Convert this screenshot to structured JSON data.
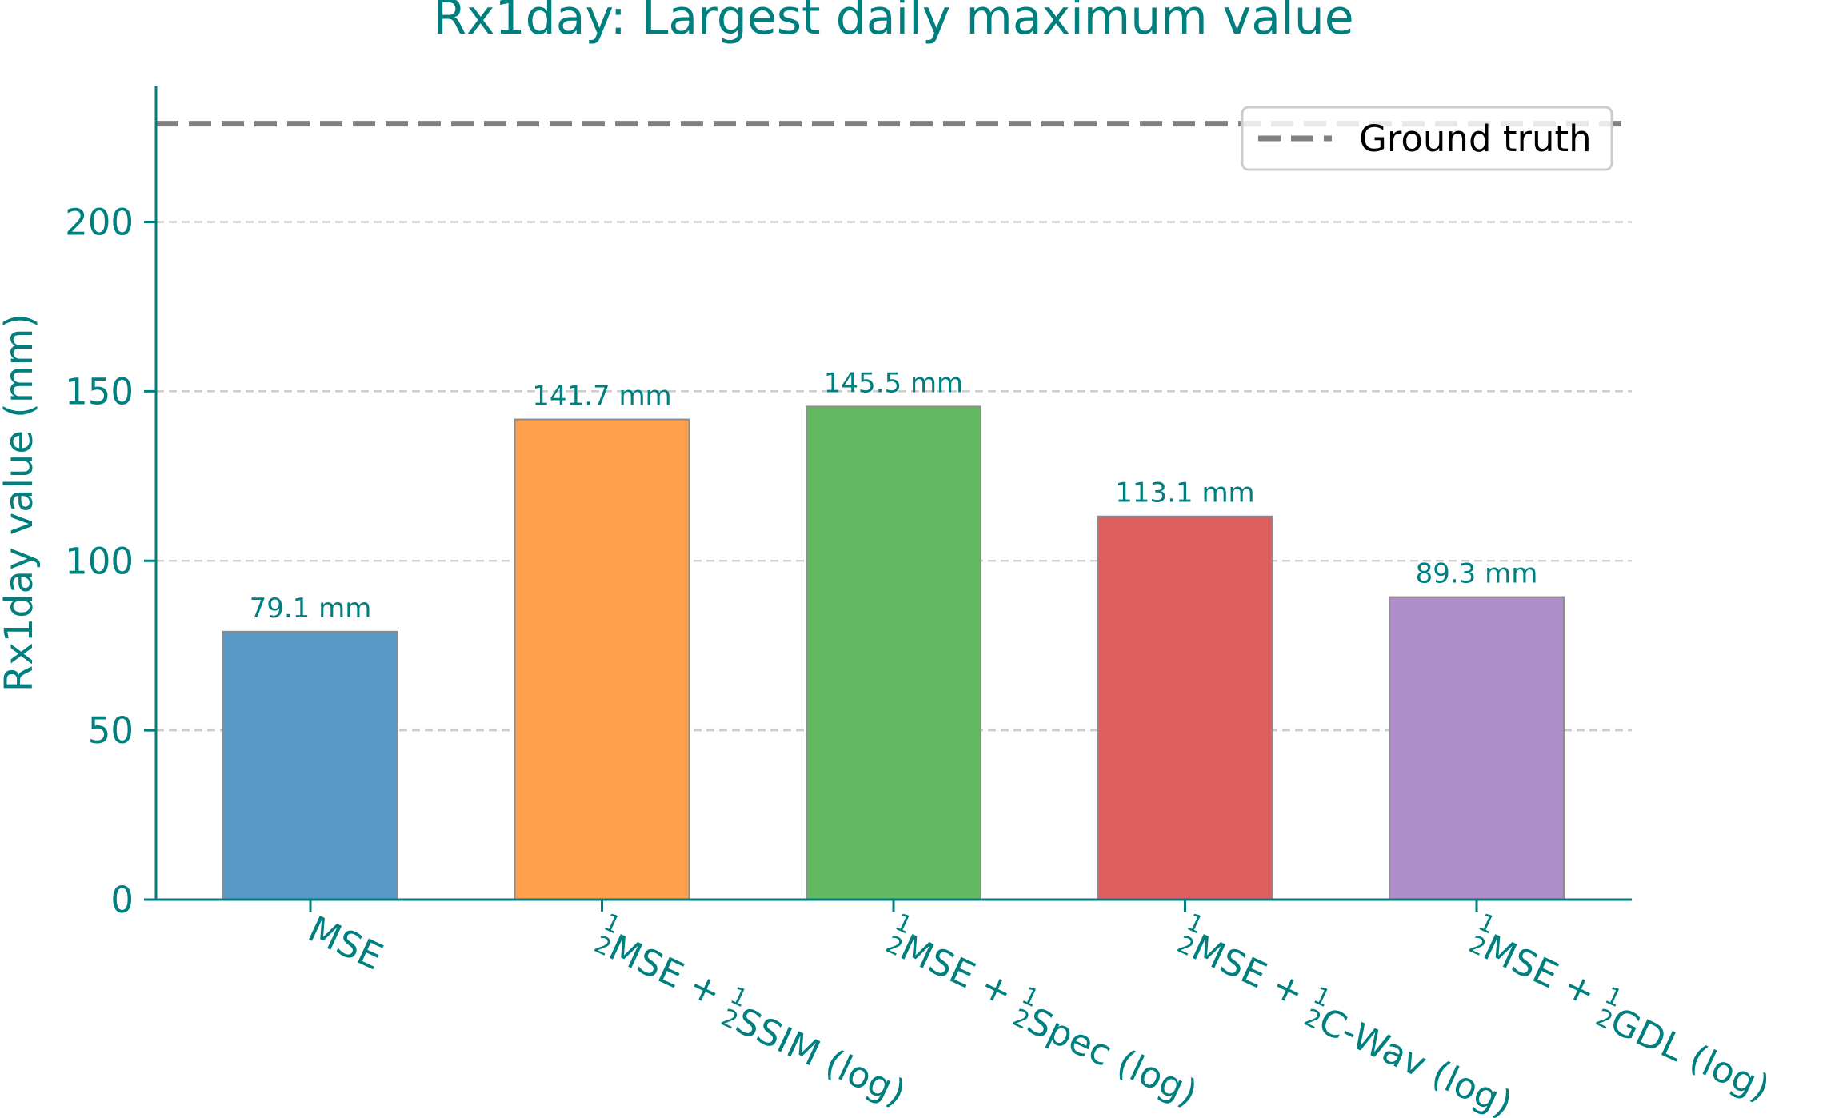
{
  "chart_data": {
    "type": "bar",
    "title": "Rx1day: Largest daily maximum value",
    "ylabel": "Rx1day value (mm)",
    "xlabel": "",
    "ylim": [
      0,
      240
    ],
    "yticks": [
      0,
      50,
      100,
      150,
      200
    ],
    "grid": "y-dashed",
    "categories": [
      "MSE",
      "½MSE + ½SSIM (log)",
      "½MSE + ½Spec (log)",
      "½MSE + ½C-Wav (log)",
      "½MSE + ½GDL (log)"
    ],
    "category_parts": [
      [
        {
          "t": "MSE"
        }
      ],
      [
        {
          "frac": "1/2"
        },
        {
          "t": "MSE + "
        },
        {
          "frac": "1/2"
        },
        {
          "t": "SSIM (log)"
        }
      ],
      [
        {
          "frac": "1/2"
        },
        {
          "t": "MSE + "
        },
        {
          "frac": "1/2"
        },
        {
          "t": "Spec (log)"
        }
      ],
      [
        {
          "frac": "1/2"
        },
        {
          "t": "MSE + "
        },
        {
          "frac": "1/2"
        },
        {
          "t": "C-Wav (log)"
        }
      ],
      [
        {
          "frac": "1/2"
        },
        {
          "t": "MSE + "
        },
        {
          "frac": "1/2"
        },
        {
          "t": "GDL (log)"
        }
      ]
    ],
    "values": [
      79.1,
      141.7,
      145.5,
      113.1,
      89.3
    ],
    "value_labels": [
      "79.1 mm",
      "141.7 mm",
      "145.5 mm",
      "113.1 mm",
      "89.3 mm"
    ],
    "bar_colors": [
      "#5899c6",
      "#fd9f4b",
      "#63b862",
      "#df5f5f",
      "#ae8dca"
    ],
    "reference_line": {
      "name": "Ground truth",
      "value": 229,
      "style": "dashed",
      "color": "#808080"
    },
    "legend_placement": "top-right",
    "colors": {
      "text": "#007f7f",
      "axis": "#007f7f",
      "grid": "#cccccc",
      "bar_edge": "#8c8c8c",
      "legend_text": "#000000",
      "legend_border": "#cccccc"
    }
  }
}
